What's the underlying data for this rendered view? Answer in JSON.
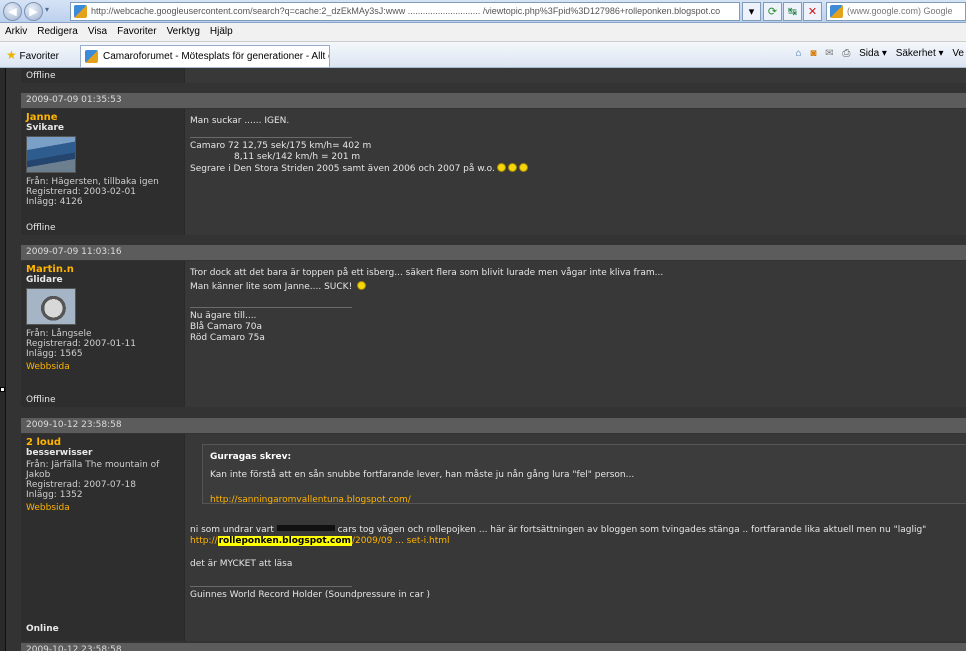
{
  "browser": {
    "url": "http://webcache.googleusercontent.com/search?q=cache:2_dzEkMAy3sJ:www ............................. /viewtopic.php%3Fpid%3D127986+rolleponken.blogspot.co",
    "search_placeholder": "(www.google.com) Google",
    "menu": [
      "Arkiv",
      "Redigera",
      "Visa",
      "Favoriter",
      "Verktyg",
      "Hjälp"
    ],
    "favorites_label": "Favoriter",
    "tab_title": "Camaroforumet - Mötesplats för generationer - Allt o...",
    "commands": [
      "Sida ▾",
      "Säkerhet ▾",
      "Ve"
    ]
  },
  "forum": {
    "top_status": "Offline",
    "posts": [
      {
        "date": "2009-07-09 01:35:53",
        "username": "Janne",
        "rank": "Svikare",
        "from": "Från: Hägersten, tillbaka igen",
        "registered": "Registrerad: 2003-02-01",
        "posts_count": "Inlägg: 4126",
        "status": "Offline",
        "message": [
          "Man suckar ...... IGEN."
        ],
        "signature": [
          "Camaro 72  12,75 sek/175 km/h= 402 m",
          "8,11 sek/142 km/h = 201 m",
          "Segrare i Den Stora Striden 2005 samt även 2006 och 2007 på w.o."
        ]
      },
      {
        "date": "2009-07-09 11:03:16",
        "username": "Martin.n",
        "rank": "Glidare",
        "from": "Från: Långsele",
        "registered": "Registrerad: 2007-01-11",
        "posts_count": "Inlägg: 1565",
        "website": "Webbsida",
        "status": "Offline",
        "message": [
          "Tror dock att det bara är toppen på ett isberg...  säkert flera som blivit lurade men vågar inte kliva fram...",
          "Man känner lite som Janne....  SUCK!"
        ],
        "signature": [
          "Nu ägare till....",
          "Blå Camaro 70a",
          "Röd Camaro 75a"
        ]
      },
      {
        "date": "2009-10-12 23:58:58",
        "username": "2 loud",
        "rank": "besserwisser",
        "from": "Från: Järfälla The mountain of Jakob",
        "registered": "Registrerad: 2007-07-18",
        "posts_count": "Inlägg: 1352",
        "website": "Webbsida",
        "status": "Online",
        "quote_header": "Gurragas skrev:",
        "quote_text": "Kan inte förstå att en sån snubbe fortfarande lever, han måste ju nån gång lura \"fel\" person...",
        "quote_link": "http://sanningaromvallentuna.blogspot.com/",
        "message_a": "ni som undrar vart",
        "message_b": "cars tog vägen och rollepojken ...  här är fortsättningen av bloggen som tvingades stänga .. fortfarande lika aktuell men nu  \"laglig\"",
        "link_prefix": "http://",
        "link_highlight": "rolleponken.blogspot.com",
        "link_suffix": "/2009/09 ... set-i.html",
        "message2": "det är MYCKET att läsa",
        "signature": "Guinnes World Record Holder  (Soundpressure in car )"
      }
    ],
    "last_date": "2009-10-12 23:58:58"
  }
}
